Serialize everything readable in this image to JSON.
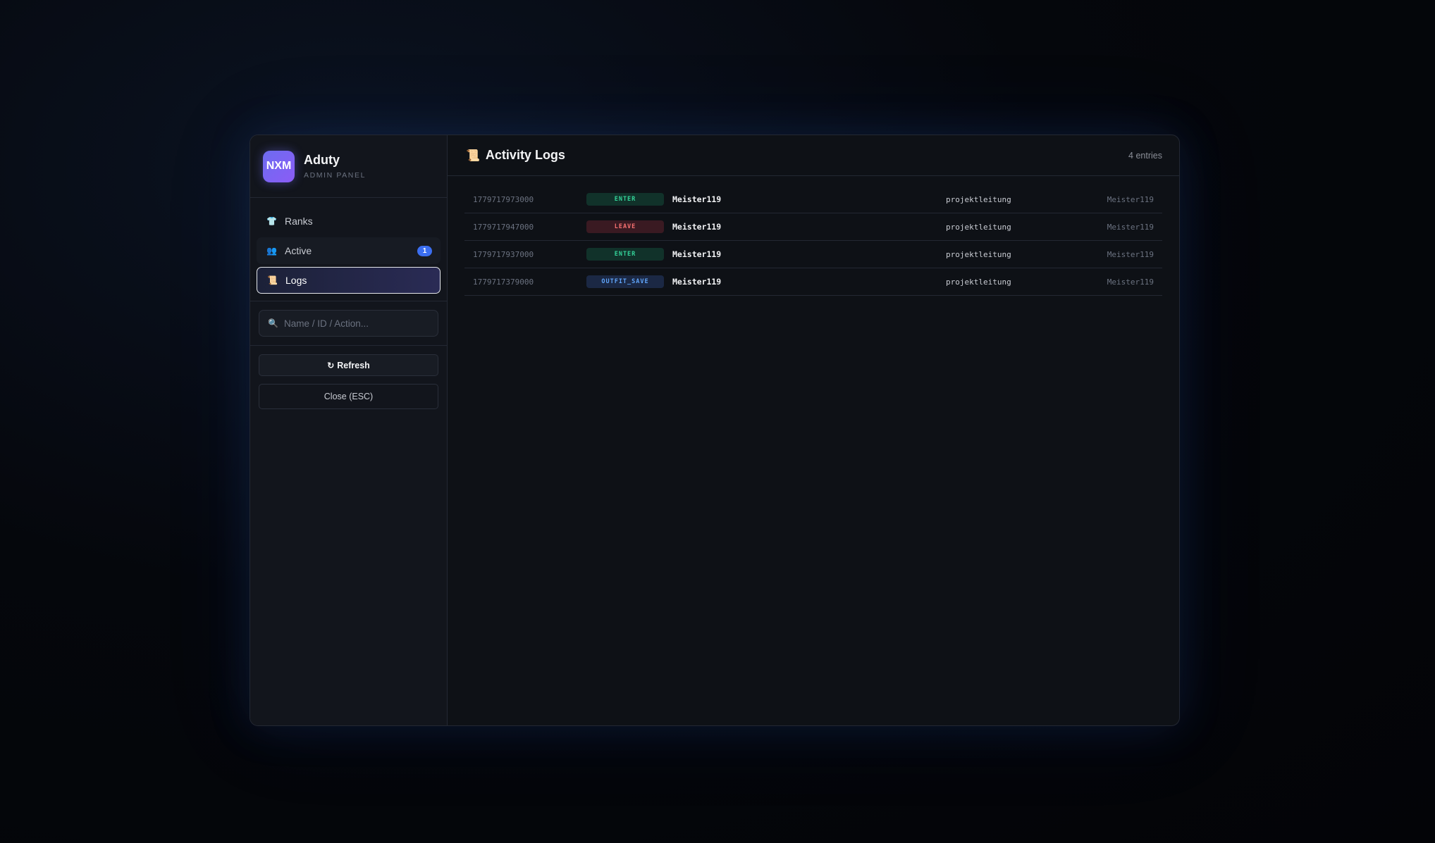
{
  "brand": {
    "logo_text": "NXM",
    "title": "Aduty",
    "subtitle": "ADMIN PANEL"
  },
  "nav": {
    "items": [
      {
        "label": "Ranks",
        "icon": "shirt-icon",
        "glyph": "👕"
      },
      {
        "label": "Active",
        "icon": "people-icon",
        "glyph": "👥",
        "badge": "1"
      },
      {
        "label": "Logs",
        "icon": "scroll-icon",
        "glyph": "📜",
        "active": true
      }
    ]
  },
  "search": {
    "placeholder": "Name / ID / Action...",
    "value": ""
  },
  "actions": {
    "refresh_label": "Refresh",
    "close_label": "Close (ESC)"
  },
  "main": {
    "title": "Activity Logs",
    "title_glyph": "📜",
    "entries_label": "4 entries"
  },
  "logs": [
    {
      "timestamp": "1779717973000",
      "action": "ENTER",
      "name": "Meister119",
      "rank": "projektleitung",
      "by": "Meister119"
    },
    {
      "timestamp": "1779717947000",
      "action": "LEAVE",
      "name": "Meister119",
      "rank": "projektleitung",
      "by": "Meister119"
    },
    {
      "timestamp": "1779717937000",
      "action": "ENTER",
      "name": "Meister119",
      "rank": "projektleitung",
      "by": "Meister119"
    },
    {
      "timestamp": "1779717379000",
      "action": "OUTFIT_SAVE",
      "name": "Meister119",
      "rank": "projektleitung",
      "by": "Meister119"
    }
  ],
  "colors": {
    "accent": "#6d6cf0",
    "badge": "#3b6ef0",
    "enter": "#34d399",
    "leave": "#f87171",
    "outfit_save": "#60a5fa"
  }
}
